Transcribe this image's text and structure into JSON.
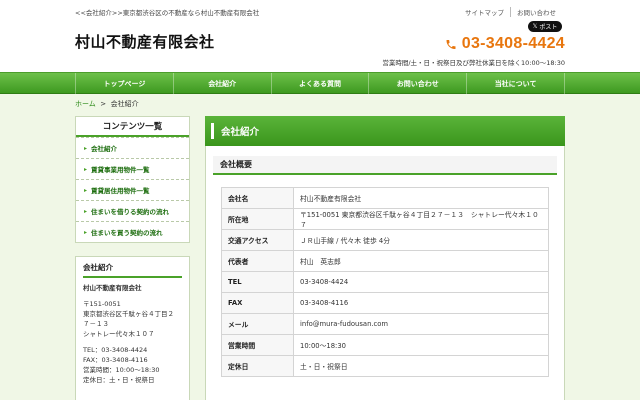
{
  "header": {
    "tagline": "<<会社紹介>>東京都渋谷区の不動産なら村山不動産有限会社",
    "title": "村山不動産有限会社",
    "toplinks": [
      "サイトマップ",
      "お問い合わせ"
    ],
    "post_label": "ポスト",
    "phone": "03-3408-4424",
    "hours": "営業時間/土・日・祝祭日及び弊社休業日を除く10:00〜18:30"
  },
  "nav": [
    "トップページ",
    "会社紹介",
    "よくある質問",
    "お問い合わせ",
    "当社について"
  ],
  "breadcrumb": {
    "home": "ホーム",
    "sep": ">",
    "current": "会社紹介"
  },
  "sidebar": {
    "title": "コンテンツ一覧",
    "items": [
      "会社紹介",
      "賃貸事業用物件一覧",
      "賃貸居住用物件一覧",
      "住まいを借りる契約の流れ",
      "住まいを買う契約の流れ"
    ],
    "info": {
      "title": "会社紹介",
      "name": "村山不動産有限会社",
      "postal": "〒151-0051",
      "address1": "東京都渋谷区千駄ヶ谷４丁目２",
      "address2": "７－１３",
      "address3": "シャトレー代々木１０７",
      "tel": "TEL：03-3408-4424",
      "fax": "FAX：03-3408-4116",
      "hours": "営業時間：10:00〜18:30",
      "holiday": "定休日：土・日・祝祭日"
    }
  },
  "main": {
    "title": "会社紹介",
    "section": "会社概要",
    "rows": [
      {
        "k": "会社名",
        "v": "村山不動産有限会社"
      },
      {
        "k": "所在地",
        "v": "〒151-0051 東京都渋谷区千駄ヶ谷４丁目２７－１３　シャトレー代々木１０７"
      },
      {
        "k": "交通アクセス",
        "v": "ＪＲ山手線 / 代々木 徒歩 4分"
      },
      {
        "k": "代表者",
        "v": "村山　英志郎"
      },
      {
        "k": "TEL",
        "v": "03-3408-4424"
      },
      {
        "k": "FAX",
        "v": "03-3408-4116"
      },
      {
        "k": "メール",
        "v": "info@mura-fudousan.com"
      },
      {
        "k": "営業時間",
        "v": "10:00〜18:30"
      },
      {
        "k": "定休日",
        "v": "土・日・祝祭日"
      }
    ]
  },
  "colors": {
    "accent": "#4aa229",
    "phone": "#e8760e"
  }
}
